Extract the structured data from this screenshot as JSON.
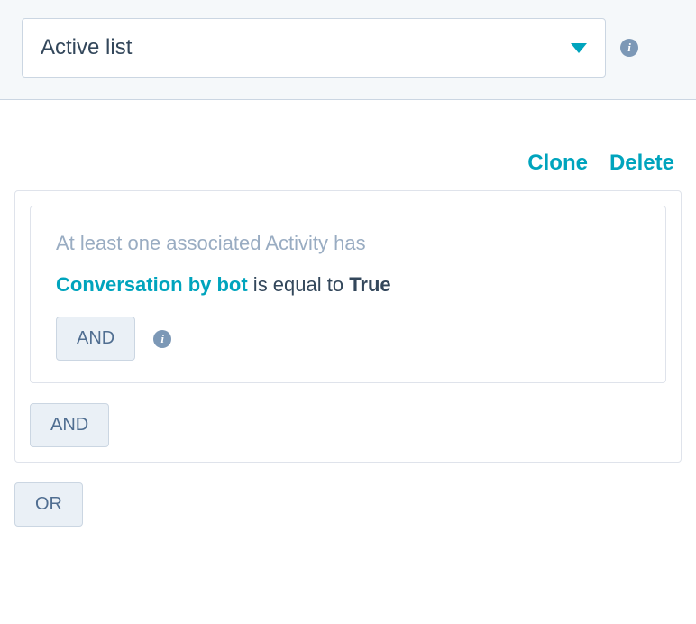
{
  "header": {
    "dropdown_value": "Active list"
  },
  "actions": {
    "clone_label": "Clone",
    "delete_label": "Delete"
  },
  "filter": {
    "heading": "At least one associated Activity has",
    "condition": {
      "property": "Conversation by bot",
      "operator": " is equal to ",
      "value": "True"
    },
    "inner_and_label": "AND",
    "outer_and_label": "AND",
    "or_label": "OR"
  }
}
